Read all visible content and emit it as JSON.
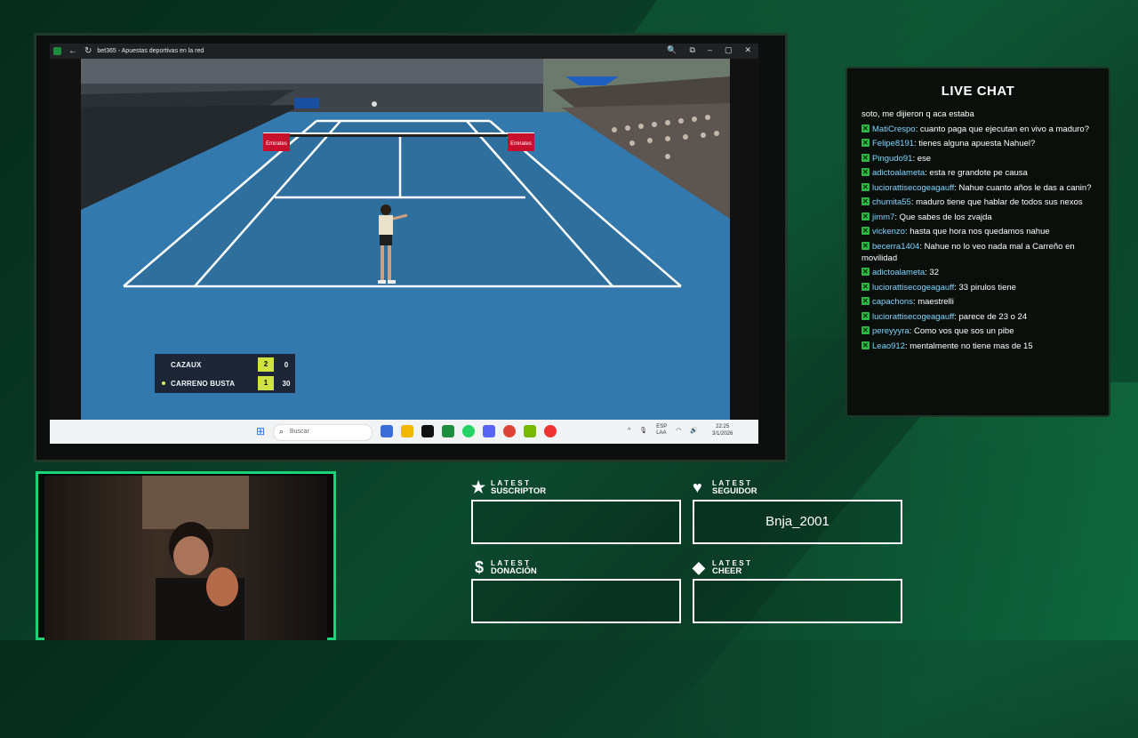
{
  "browser": {
    "tab_title": "bet365 - Apuestas deportivas en la red",
    "nav_back": "←",
    "nav_reload": "↻",
    "controls": [
      "🔍",
      "⧉",
      "–",
      "▢",
      "✕"
    ]
  },
  "scoreboard": {
    "players": [
      {
        "name": "CAZAUX",
        "sets": "2",
        "games": "0",
        "serving": false
      },
      {
        "name": "CARRENO BUSTA",
        "sets": "1",
        "games": "30",
        "serving": true
      }
    ]
  },
  "court_banners": [
    "Emirates",
    "Emirates"
  ],
  "taskbar": {
    "search_placeholder": "Buscar",
    "language": "ESP\nLAA",
    "time": "22:25",
    "date": "3/1/2026"
  },
  "chat": {
    "title": "LIVE CHAT",
    "messages": [
      {
        "user": "",
        "text": "soto, me dijieron q aca estaba"
      },
      {
        "user": "MatiCrespo",
        "text": ": cuanto paga que ejecutan en vivo a maduro?"
      },
      {
        "user": "Felipe8191",
        "text": ": tienes alguna apuesta Nahuel?"
      },
      {
        "user": "Pingudo91",
        "text": ": ese"
      },
      {
        "user": "adictoalameta",
        "text": ": esta re grandote pe causa"
      },
      {
        "user": "luciorattisecogeagauff",
        "text": ": Nahue cuanto años le das a canin?"
      },
      {
        "user": "chumita55",
        "text": ": maduro tiene que hablar de todos sus nexos"
      },
      {
        "user": "jimm7",
        "text": ": Que sabes de los zvajda"
      },
      {
        "user": "vickenzo",
        "text": ": hasta que hora nos quedamos nahue"
      },
      {
        "user": "becerra1404",
        "text": ": Nahue no lo veo nada mal a Carreño en movilidad"
      },
      {
        "user": "adictoalameta",
        "text": ": 32"
      },
      {
        "user": "luciorattisecogeagauff",
        "text": ": 33 pirulos tiene"
      },
      {
        "user": "capachons",
        "text": ": maestrelli"
      },
      {
        "user": "luciorattisecogeagauff",
        "text": ": parece de 23 o 24"
      },
      {
        "user": "pereyyyra",
        "text": ": Como vos que sos un pibe"
      },
      {
        "user": "Leao912",
        "text": ": mentalmente no tiene mas de 15"
      }
    ]
  },
  "latest": {
    "suscriptor": {
      "small": "LATEST",
      "label": "SUSCRIPTOR",
      "value": "",
      "icon": "star-icon"
    },
    "seguidor": {
      "small": "LATEST",
      "label": "SEGUIDOR",
      "value": "Bnja_2001",
      "icon": "heart-icon"
    },
    "donacion": {
      "small": "LATEST",
      "label": "DONACIÓN",
      "value": "",
      "icon": "dollar-icon"
    },
    "cheer": {
      "small": "LATEST",
      "label": "CHEER",
      "value": "",
      "icon": "diamond-icon"
    }
  }
}
